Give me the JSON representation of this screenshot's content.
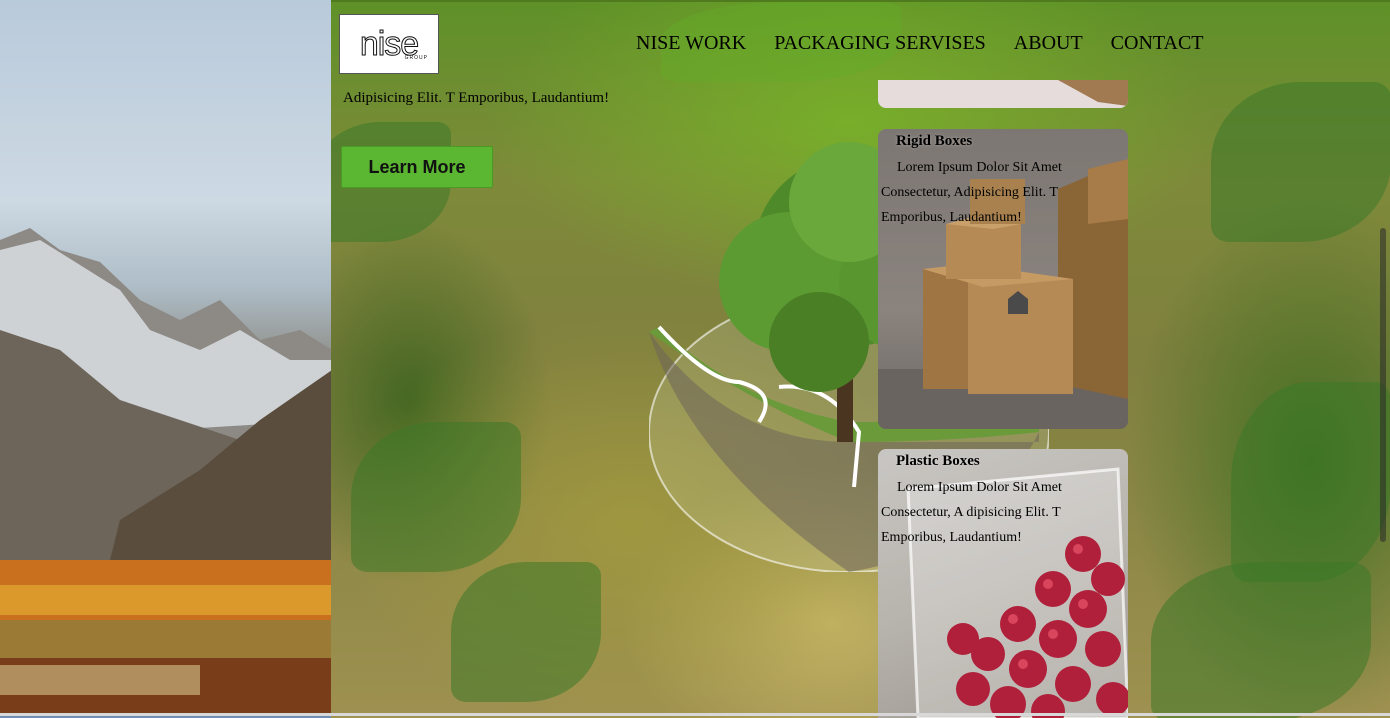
{
  "header": {
    "logo_text": "nise",
    "logo_sub": "GROUP",
    "nav": [
      "NISE WORK",
      "PACKAGING SERVISES",
      "ABOUT",
      "CONTACT"
    ]
  },
  "hero": {
    "text": "Adipisicing Elit. T Emporibus, Laudantium!",
    "button_label": "Learn More"
  },
  "cards": [
    {
      "title": "Rigid Boxes",
      "description": "Lorem Ipsum Dolor Sit Amet Consectetur, Adipisicing Elit. T Emporibus, Laudantium!"
    },
    {
      "title": "Plastic Boxes",
      "description": "Lorem Ipsum Dolor Sit Amet Consectetur, A dipisicing Elit. T Emporibus, Laudantium!"
    }
  ],
  "colors": {
    "button": "#5bb631",
    "page_green": "#5f9128"
  }
}
